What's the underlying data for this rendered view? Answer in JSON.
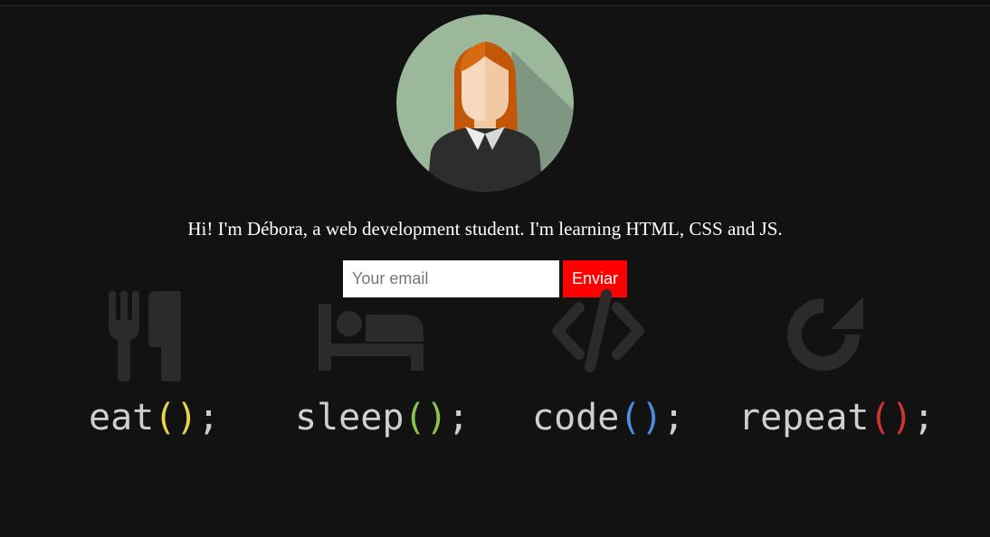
{
  "intro": {
    "text": "Hi! I'm Débora, a web development student. I'm learning HTML, CSS and JS."
  },
  "signup": {
    "email_placeholder": "Your email",
    "send_label": "Enviar"
  },
  "motto": [
    {
      "word": "eat",
      "open": "(",
      "close": ")",
      "end": ";",
      "paren_color": "#e8d44d",
      "icon": "utensils-icon"
    },
    {
      "word": "sleep",
      "open": "(",
      "close": ")",
      "end": ";",
      "paren_color": "#8bc34a",
      "icon": "bed-icon"
    },
    {
      "word": "code",
      "open": "(",
      "close": ")",
      "end": ";",
      "paren_color": "#4a90e2",
      "icon": "code-icon"
    },
    {
      "word": "repeat",
      "open": "(",
      "close": ")",
      "end": ";",
      "paren_color": "#d0352f",
      "icon": "repeat-icon"
    }
  ],
  "colors": {
    "background": "#121212",
    "accent": "#ff0000",
    "icon": "#2b2b2b",
    "text": "#cfcfcf"
  }
}
